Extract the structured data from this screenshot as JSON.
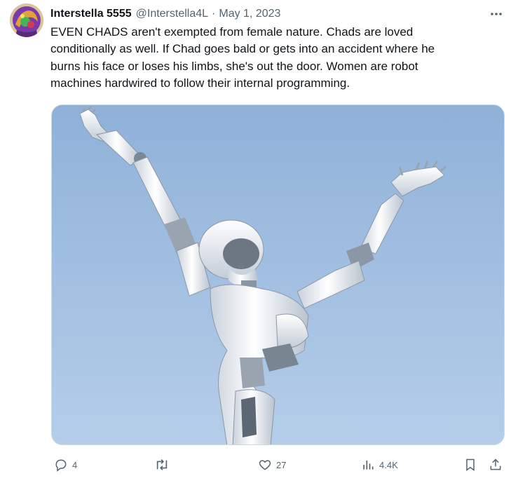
{
  "author": {
    "name": "Interstella 5555",
    "handle": "@Interstella4L",
    "separator": "·",
    "date": "May 1, 2023",
    "avatar_icon": "avatar-art"
  },
  "post": {
    "lines": [
      "EVEN CHADS aren't exempted from female nature. Chads are loved",
      "conditionally as well. If Chad goes bald or gets into an accident where he",
      "burns his face or loses his limbs, she's out the door. Women are robot",
      "machines hardwired to follow their internal programming."
    ]
  },
  "media": {
    "description_icon": "robot-arms-raised-image",
    "sky_color": "#9dbce0"
  },
  "actions": {
    "reply_count": "4",
    "retweet_count": "",
    "like_count": "27",
    "views_count": "4.4K"
  },
  "colors": {
    "text": "#0f1419",
    "muted": "#536471",
    "border": "#cfd9de"
  }
}
